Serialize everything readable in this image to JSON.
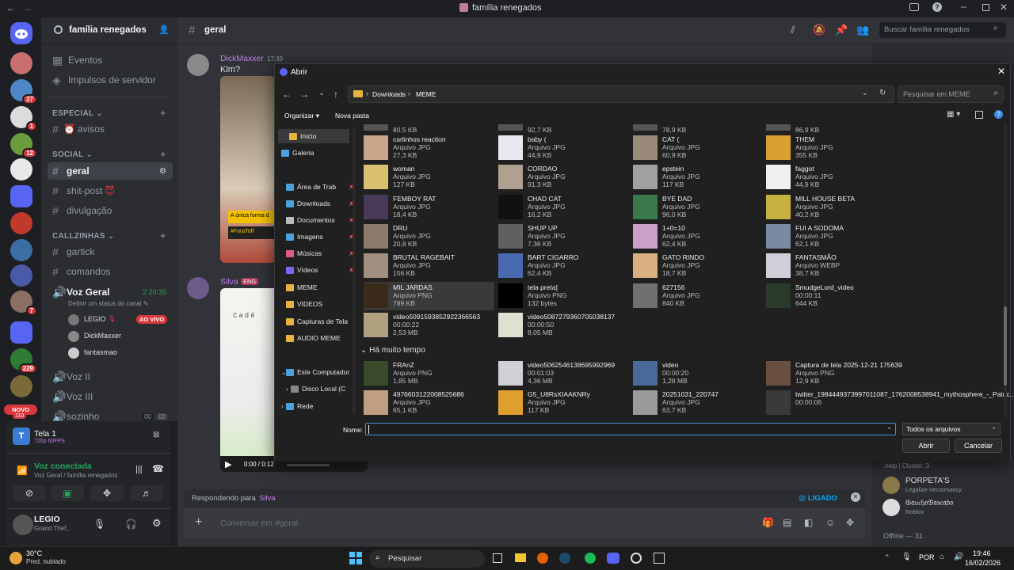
{
  "window": {
    "title": "família renegados"
  },
  "server": {
    "name": "família renegados"
  },
  "channel_header": {
    "channel": "geral",
    "search_placeholder": "Buscar família renegados"
  },
  "sidebar_top": [
    {
      "label": "Eventos"
    },
    {
      "label": "Impulsos de servidor"
    }
  ],
  "categories": {
    "especial": "ESPECIAL",
    "social": "SOCIAL",
    "callzinhas": "CALLZINHAS"
  },
  "channels": {
    "avisos": "avisos",
    "geral": "geral",
    "shitpost": "shit-post",
    "divulgacao": "divulgação",
    "gartick": "gartick",
    "comandos": "comandos",
    "voz_geral": "Voz Geral",
    "voz_geral_timer": "2:20:35",
    "voz_status": "Definir um status do canal",
    "voz2": "Voz II",
    "voz3": "Voz III",
    "sozinho": "sozinho",
    "sozinho_count_a": "00",
    "sozinho_count_b": "02"
  },
  "voice_users": [
    {
      "name": "LEGIO",
      "badge": "AO VIVO"
    },
    {
      "name": "DickMaxxer"
    },
    {
      "name": "fantasmao"
    }
  ],
  "server_badges": [
    "27",
    "1",
    "12",
    "229",
    "7"
  ],
  "novo_badge": "NOVO",
  "novo_count": "110",
  "screen_share": {
    "title": "Tela 1",
    "quality": "720p 60FPS"
  },
  "voice_connected": {
    "status": "Voz conectada",
    "location": "Voz Geral / família renegados"
  },
  "user": {
    "name": "LEGIO",
    "activity": "Grand Thef..."
  },
  "messages": [
    {
      "author": "DickMaxxer",
      "time": "17:39",
      "text": "Klm?"
    },
    {
      "author": "Silva",
      "tag": "ENG"
    }
  ],
  "video_overlay": {
    "banner": "A única forma d",
    "hashtag": "#ForaToff"
  },
  "video_player": {
    "time": "0:00 / 0:12",
    "title_text": "Cadê"
  },
  "reply": {
    "prefix": "Respondendo para",
    "target": "Silva",
    "ping": "@ LIGADO"
  },
  "composer": {
    "placeholder": "Conversar em #geral"
  },
  "members": [
    {
      "name": ".help | Cluster: 3"
    },
    {
      "name": "PORPETA'S",
      "activity": "Legalize necromancy"
    },
    {
      "name": "𝔊𝔞𝔲𝔠𝔥𝔬𝔅𝔞𝔰𝔢𝔞𝔡𝔬",
      "activity": "Roblox"
    }
  ],
  "offline": "Offline — 31",
  "dialog": {
    "title": "Abrir",
    "breadcrumb": [
      "Downloads",
      "MEME"
    ],
    "search_placeholder": "Pesquisar em MEME",
    "organize": "Organizar",
    "new_folder": "Nova pasta",
    "nav": [
      {
        "label": "Início"
      },
      {
        "label": "Galeria"
      },
      {
        "label": "Área de Trab"
      },
      {
        "label": "Downloads"
      },
      {
        "label": "Documentos"
      },
      {
        "label": "Imagens"
      },
      {
        "label": "Músicas"
      },
      {
        "label": "Vídeos"
      },
      {
        "label": "MEME"
      },
      {
        "label": "VIDEOS"
      },
      {
        "label": "Capturas de Tela"
      },
      {
        "label": "AUDIO MEME"
      },
      {
        "label": "Este Computador"
      },
      {
        "label": "Disco Local (C"
      },
      {
        "label": "Rede"
      }
    ],
    "top_sizes": [
      "80,5 KB",
      "92,7 KB",
      "78,9 KB",
      "86,9 KB"
    ],
    "files": [
      {
        "name": "carlinhos reaction",
        "type": "Arquivo JPG",
        "size": "27,3 KB"
      },
      {
        "name": "baby (",
        "type": "Arquivo JPG",
        "size": "44,9 KB"
      },
      {
        "name": "CAT (",
        "type": "Arquivo JPG",
        "size": "60,9 KB"
      },
      {
        "name": "THEM",
        "type": "Arquivo JPG",
        "size": "355 KB"
      },
      {
        "name": "woman",
        "type": "Arquivo JPG",
        "size": "127 KB"
      },
      {
        "name": "CORDAO",
        "type": "Arquivo JPG",
        "size": "91,3 KB"
      },
      {
        "name": "epstein",
        "type": "Arquivo JPG",
        "size": "117 KB"
      },
      {
        "name": "faggot",
        "type": "Arquivo JPG",
        "size": "44,9 KB"
      },
      {
        "name": "FEMBOY RAT",
        "type": "Arquivo JPG",
        "size": "18,4 KB"
      },
      {
        "name": "CHAD CAT",
        "type": "Arquivo JPG",
        "size": "16,2 KB"
      },
      {
        "name": "BYE DAD",
        "type": "Arquivo JPG",
        "size": "96,0 KB"
      },
      {
        "name": "MILL HOUSE BETA",
        "type": "Arquivo JPG",
        "size": "40,2 KB"
      },
      {
        "name": "DRU",
        "type": "Arquivo JPG",
        "size": "20,8 KB"
      },
      {
        "name": "SHUP UP",
        "type": "Arquivo JPG",
        "size": "7,36 KB"
      },
      {
        "name": "1+0=10",
        "type": "Arquivo JPG",
        "size": "62,4 KB"
      },
      {
        "name": "FUI A SODOMA",
        "type": "Arquivo JPG",
        "size": "62,1 KB"
      },
      {
        "name": "BRUTAL RAGEBAIT",
        "type": "Arquivo JPG",
        "size": "156 KB"
      },
      {
        "name": "BART CIGARRO",
        "type": "Arquivo JPG",
        "size": "62,4 KB"
      },
      {
        "name": "GATO RINDO",
        "type": "Arquivo JPG",
        "size": "18,7 KB"
      },
      {
        "name": "FANTASMÃO",
        "type": "Arquivo WEBP",
        "size": "38,7 KB"
      },
      {
        "name": "MIL JARDAS",
        "type": "Arquivo PNG",
        "size": "789 KB"
      },
      {
        "name": "tela preta]",
        "type": "Arquivo PNG",
        "size": "132 bytes"
      },
      {
        "name": "627156",
        "type": "Arquivo JPG",
        "size": "840 KB"
      },
      {
        "name": "SmudgeLord_video",
        "type": "00:00:11",
        "size": "644 KB"
      },
      {
        "name": "video5091593852922366563",
        "type": "00:00:22",
        "size": "2,53 MB"
      },
      {
        "name": "video5087279360705038137",
        "type": "00:00:50",
        "size": "8,05 MB"
      }
    ],
    "group_label": "Há muito tempo",
    "old_files": [
      {
        "name": "FRAnZ",
        "type": "Arquivo PNG",
        "size": "1,85 MB"
      },
      {
        "name": "video5062546138695992969",
        "type": "00:01:03",
        "size": "4,36 MB"
      },
      {
        "name": "video",
        "type": "00:00:20",
        "size": "1,28 MB"
      },
      {
        "name": "Captura de tela 2025-12-21 175639",
        "type": "Arquivo PNG",
        "size": "12,9 KB"
      },
      {
        "name": "4976603122008525686",
        "type": "Arquivo JPG",
        "size": "65,1 KB"
      },
      {
        "name": "G5_U8RsXIAAKNRy",
        "type": "Arquivo JPG",
        "size": "117 KB"
      },
      {
        "name": "20251031_220747",
        "type": "Arquivo JPG",
        "size": "63,7 KB"
      },
      {
        "name": "twitter_1984449373997011087_1762008538941_mythosphere_-_Patric...",
        "type": "00:00:06",
        "size": ""
      }
    ],
    "name_label": "Nome:",
    "name_value": "",
    "filter": "Todos os arquivos",
    "open": "Abrir",
    "cancel": "Cancelar"
  },
  "taskbar": {
    "weather_temp": "30°C",
    "weather_desc": "Pred. nublado",
    "search": "Pesquisar",
    "lang": "POR",
    "time": "19:46",
    "date": "16/02/2026"
  },
  "colors": {
    "blurple": "#5865f2",
    "green": "#23a55a",
    "red": "#da373c",
    "link": "#00a8fc"
  }
}
